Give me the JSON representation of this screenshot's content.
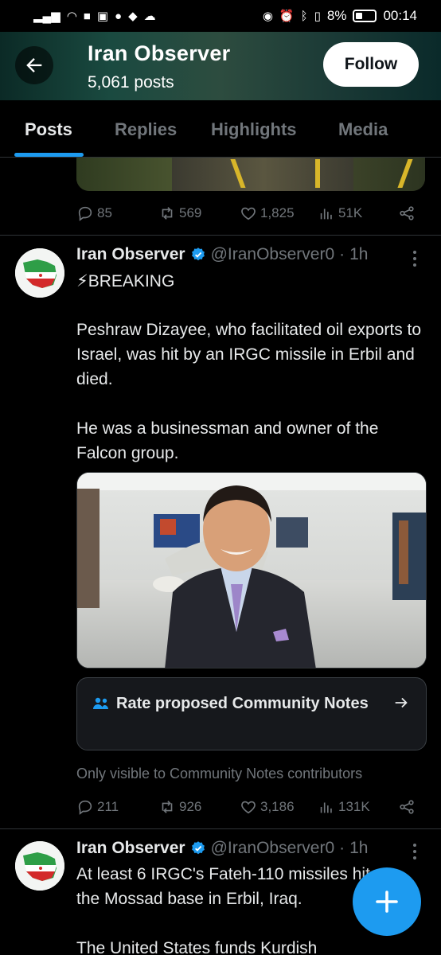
{
  "status_bar": {
    "left_icons": [
      "signal-icon",
      "wifi-icon",
      "facebook-icon",
      "photo-icon",
      "heart-icon",
      "chat-icon",
      "shopping-icon",
      "cloud-icon"
    ],
    "right_icons": [
      "eye-icon",
      "alarm-icon",
      "bluetooth-icon",
      "vibrate-icon"
    ],
    "battery": "8%",
    "time": "00:14"
  },
  "header": {
    "title": "Iran Observer",
    "posts_count": "5,061 posts",
    "follow_label": "Follow"
  },
  "tabs": [
    {
      "label": "Posts",
      "active": true
    },
    {
      "label": "Replies",
      "active": false
    },
    {
      "label": "Highlights",
      "active": false
    },
    {
      "label": "Media",
      "active": false
    }
  ],
  "prev_tweet": {
    "replies": "85",
    "reposts": "569",
    "likes": "1,825",
    "views": "51K"
  },
  "tweet1": {
    "author": "Iran Observer",
    "handle": "@IranObserver0",
    "dot": "·",
    "time": "1h",
    "line1": "⚡BREAKING",
    "para1": "Peshraw Dizayee, who facilitated oil exports to Israel, was hit by an IRGC missile in Erbil and died.",
    "para2": "He was a businessman and owner of the Falcon group.",
    "community_note_label": "Rate proposed Community Notes",
    "community_note_caption": "Only visible to Community Notes contributors",
    "replies": "211",
    "reposts": "926",
    "likes": "3,186",
    "views": "131K"
  },
  "tweet2": {
    "author": "Iran Observer",
    "handle": "@IranObserver0",
    "dot": "·",
    "time": "1h",
    "text_line1": "At least 6 IRGC's Fateh-110 missiles hit",
    "text_line2": "the Mossad base in Erbil, Iraq.",
    "text_line3": "The United States funds Kurdish"
  },
  "colors": {
    "accent": "#1d9bf0",
    "muted": "#71767b",
    "text": "#e7e9ea",
    "background": "#000000",
    "divider": "#2f3336"
  }
}
